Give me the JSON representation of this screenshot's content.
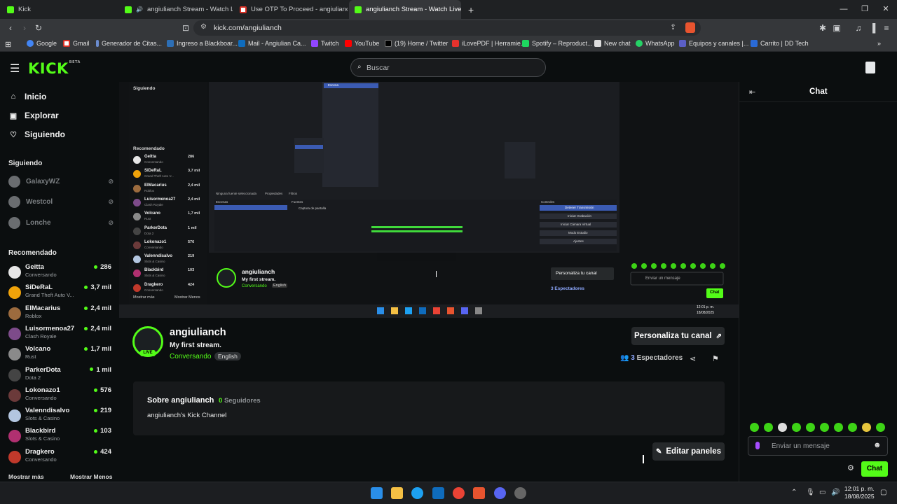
{
  "browser": {
    "tabs": [
      {
        "label": "Kick",
        "active": false
      },
      {
        "label": "angiulianch Stream - Watch Live",
        "active": false
      },
      {
        "label": "Use OTP To Proceed - angiuliancap@",
        "active": false
      },
      {
        "label": "angiulianch Stream - Watch Live",
        "active": true
      }
    ],
    "url": "kick.com/angiulianch",
    "bookmarks": [
      "Google",
      "Gmail",
      "Generador de Citas...",
      "Ingreso a Blackboar...",
      "Mail - Angiulian Ca...",
      "Twitch",
      "YouTube",
      "(19) Home / Twitter",
      "iLovePDF | Herramie...",
      "Spotify – Reproduct...",
      "New chat",
      "WhatsApp",
      "Equipos y canales |...",
      "Carrito | DD Tech"
    ]
  },
  "kick": {
    "logo": "KICK",
    "logo_sup": "BETA",
    "search_placeholder": "Buscar",
    "nav": [
      {
        "label": "Inicio",
        "icon": "home-icon"
      },
      {
        "label": "Explorar",
        "icon": "compass-icon"
      },
      {
        "label": "Siguiendo",
        "icon": "heart-icon"
      }
    ],
    "following_title": "Siguiendo",
    "following": [
      "GalaxyWZ",
      "Westcol",
      "Lonche"
    ],
    "recommended_title": "Recomendado",
    "recommended": [
      {
        "name": "Geitta",
        "category": "Conversando",
        "viewers": "286"
      },
      {
        "name": "SiDeRaL",
        "category": "Grand Theft Auto V...",
        "viewers": "3,7 mil"
      },
      {
        "name": "ElMacarius",
        "category": "Roblox",
        "viewers": "2,4 mil"
      },
      {
        "name": "Luisormenoa27",
        "category": "Clash Royale",
        "viewers": "2,4 mil"
      },
      {
        "name": "Volcano",
        "category": "Rust",
        "viewers": "1,7 mil"
      },
      {
        "name": "ParkerDota",
        "category": "Dota 2",
        "viewers": "1 mil"
      },
      {
        "name": "Lokonazo1",
        "category": "Conversando",
        "viewers": "576"
      },
      {
        "name": "Valenndisalvo",
        "category": "Slots & Casino",
        "viewers": "219"
      },
      {
        "name": "Blackbird",
        "category": "Slots & Casino",
        "viewers": "103"
      },
      {
        "name": "Dragkero",
        "category": "Conversando",
        "viewers": "424"
      }
    ],
    "show_more": "Mostrar más",
    "show_less": "Mostrar Menos",
    "stream": {
      "streamer": "angiulianch",
      "title": "My first stream.",
      "category": "Conversando",
      "language": "English",
      "live_label": "LIVE",
      "customize_button": "Personaliza tu canal",
      "viewers": "3",
      "viewers_label": "Espectadores"
    },
    "about": {
      "heading": "Sobre angiulianch",
      "followers_count": "0",
      "followers_label": "Seguidores",
      "bio": "angiulianch's Kick Channel"
    },
    "edit_panels": "Editar paneles",
    "chat": {
      "title": "Chat",
      "input_placeholder": "Enviar un mensaje",
      "send_button": "Chat"
    },
    "video_overlay": {
      "streamer": "angiulianch",
      "title": "My first stream.",
      "category": "Conversando",
      "language": "English",
      "customize": "Personaliza tu canal",
      "viewers": "3 Espectadores",
      "chat_placeholder": "Enviar un mensaje",
      "chat_btn": "Chat",
      "following_label": "Siguiendo",
      "recommended_label": "Recomendado",
      "show_more": "Mostrar más",
      "show_less": "Mostrar Menos",
      "time": "12:01 p. m.",
      "date": "18/08/2025",
      "obs_scene": "Escena",
      "obs_no_source": "Ninguna fuente seleccionada",
      "obs_properties": "Propiedades",
      "obs_filters": "Filtros",
      "obs_scenes": "Escenas",
      "obs_sources": "Fuentes",
      "obs_source_item": "Captura de pantalla",
      "obs_controls": "Controles",
      "obs_start_stream": "Detener Transmisión",
      "obs_record": "Iniciar Grabación",
      "obs_vcam": "Iniciar Cámara Virtual",
      "obs_studio": "Modo Estudio",
      "obs_settings": "Ajustes",
      "mini_rec": [
        {
          "name": "Geitta",
          "category": "Conversando",
          "viewers": "286"
        },
        {
          "name": "SiDeRaL",
          "category": "Grand Theft Auto V...",
          "viewers": "3,7 mil"
        },
        {
          "name": "ElMacarius",
          "category": "Roblox",
          "viewers": "2,4 mil"
        },
        {
          "name": "Luisormenoa27",
          "category": "Clash Royale",
          "viewers": "2,4 mil"
        },
        {
          "name": "Volcano",
          "category": "Rust",
          "viewers": "1,7 mil"
        },
        {
          "name": "ParkerDota",
          "category": "Dota 2",
          "viewers": "1 mil"
        },
        {
          "name": "Lokonazo1",
          "category": "Conversando",
          "viewers": "576"
        },
        {
          "name": "Valenndisalvo",
          "category": "Slots & Casino",
          "viewers": "219"
        },
        {
          "name": "Blackbird",
          "category": "Slots & Casino",
          "viewers": "103"
        },
        {
          "name": "Dragkero",
          "category": "Conversando",
          "viewers": "424"
        }
      ]
    }
  },
  "taskbar": {
    "time": "12:01 p. m.",
    "date": "18/08/2025"
  },
  "colors": {
    "accent": "#53fc18",
    "background": "#0b0e0f"
  }
}
